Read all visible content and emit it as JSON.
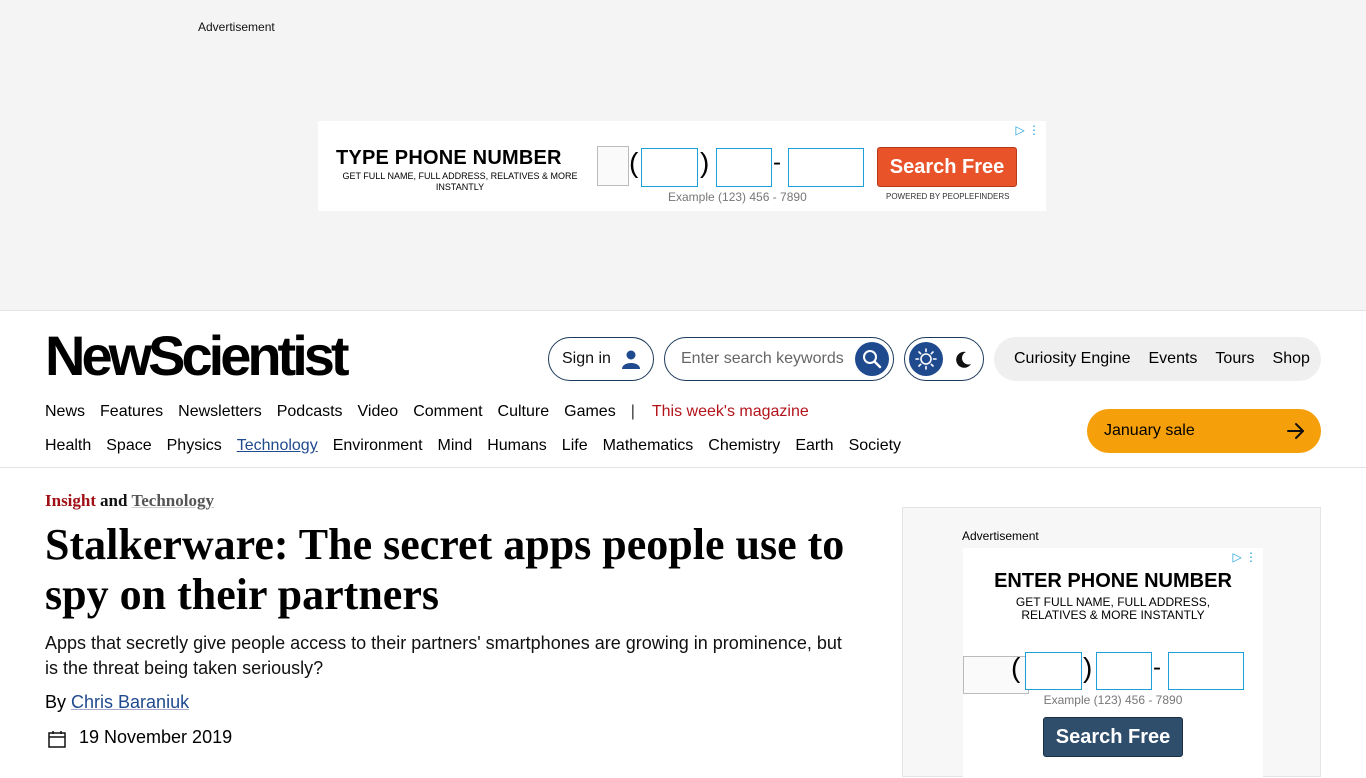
{
  "ads": {
    "top_label": "Advertisement",
    "top_banner": {
      "headline": "TYPE PHONE NUMBER",
      "subline": "GET FULL NAME, FULL ADDRESS, RELATIVES & MORE INSTANTLY",
      "example": "Example (123) 456 - 7890",
      "button": "Search Free",
      "powered": "POWERED BY PEOPLEFINDERS",
      "open_paren": "(",
      "close_paren": ")",
      "dash": "-",
      "button_color": "#e8532a"
    },
    "side_label": "Advertisement",
    "side_banner": {
      "headline": "ENTER PHONE NUMBER",
      "subline": "GET FULL NAME, FULL ADDRESS, RELATIVES & MORE INSTANTLY",
      "example": "Example (123) 456 - 7890",
      "button": "Search Free",
      "open_paren": "(",
      "close_paren": ")",
      "dash": "-",
      "button_color": "#2e4e6c"
    }
  },
  "header": {
    "logo": "NewScientist",
    "sign_in": "Sign in",
    "search_placeholder": "Enter search keywords",
    "top_nav": [
      "Curiosity Engine",
      "Events",
      "Tours",
      "Shop"
    ],
    "primary_nav": [
      "News",
      "Features",
      "Newsletters",
      "Podcasts",
      "Video",
      "Comment",
      "Culture",
      "Games"
    ],
    "separator": "|",
    "magazine_link": "This week's magazine",
    "topic_nav": [
      "Health",
      "Space",
      "Physics",
      "Technology",
      "Environment",
      "Mind",
      "Humans",
      "Life",
      "Mathematics",
      "Chemistry",
      "Earth",
      "Society"
    ],
    "active_topic": "Technology",
    "sale_button": "January sale",
    "accent_color": "#1f4a8e",
    "sale_color": "#f59f0a",
    "magazine_color": "#b3141b"
  },
  "article": {
    "kicker_section": "Insight",
    "kicker_and": "and",
    "kicker_topic": "Technology",
    "headline": "Stalkerware: The secret apps people use to spy on their partners",
    "standfirst": "Apps that secretly give people access to their partners' smartphones are growing in prominence, but is the threat being taken seriously?",
    "byline_prefix": "By",
    "author": "Chris Baraniuk",
    "date": "19 November 2019"
  }
}
